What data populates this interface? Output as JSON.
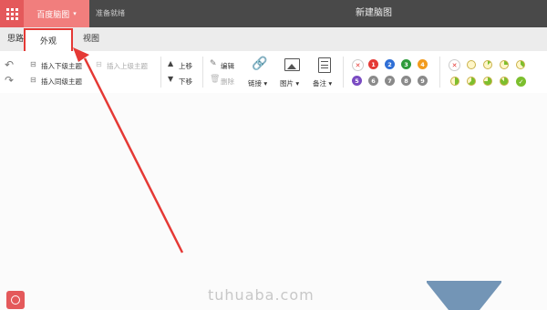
{
  "titlebar": {
    "brand": "百度脑图",
    "status": "准备就绪",
    "doc_title": "新建脑图"
  },
  "tabs": [
    {
      "label": "思路"
    },
    {
      "label": "外观"
    },
    {
      "label": "视图"
    }
  ],
  "toolbar": {
    "insert_child": "插入下级主题",
    "insert_parent": "插入上级主题",
    "insert_sibling": "插入同级主题",
    "move_up": "上移",
    "move_down": "下移",
    "edit": "编辑",
    "delete": "删除",
    "link": "链接",
    "image": "图片",
    "note": "备注",
    "priorities": [
      "1",
      "2",
      "3",
      "4",
      "5",
      "6",
      "7",
      "8",
      "9"
    ],
    "priority_colors": [
      "#e53935",
      "#2f6fd6",
      "#2e9b3a",
      "#f29b1d",
      "#7a4bc2",
      "#8a8a8a",
      "#8a8a8a",
      "#8a8a8a",
      "#8a8a8a"
    ]
  },
  "watermark": "tuhuaba.com",
  "colors": {
    "accent": "#e4595b",
    "titlebar": "#494949",
    "highlight": "#e53935"
  }
}
